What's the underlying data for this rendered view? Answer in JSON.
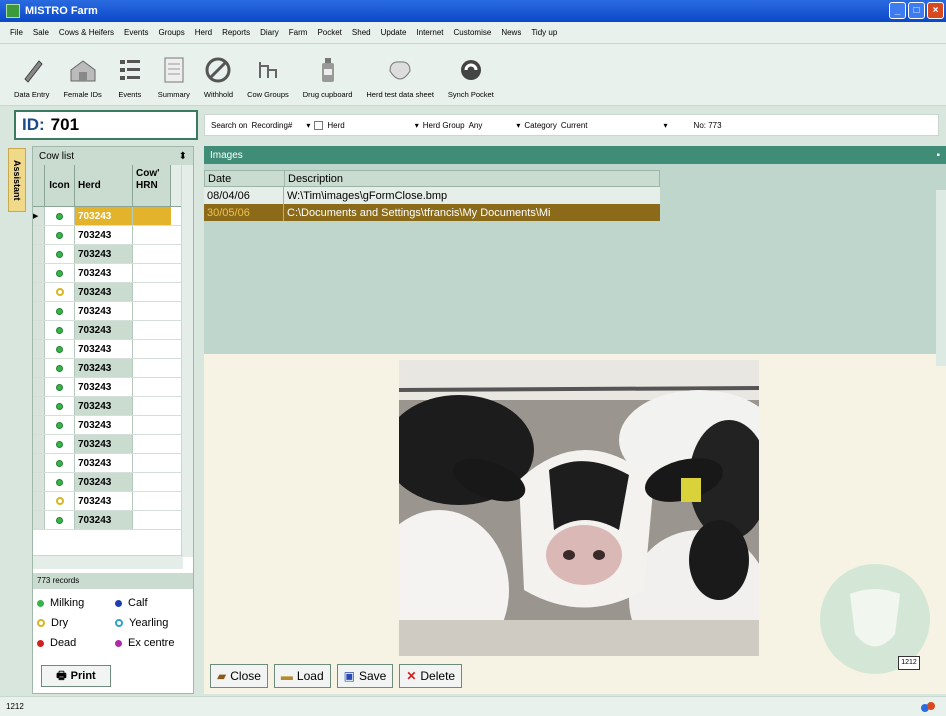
{
  "window": {
    "title": "MISTRO Farm"
  },
  "menu": [
    "File",
    "Sale",
    "Cows & Heifers",
    "Events",
    "Groups",
    "Herd",
    "Reports",
    "Diary",
    "Farm",
    "Pocket",
    "Shed",
    "Update",
    "Internet",
    "Customise",
    "News",
    "Tidy up"
  ],
  "toolbar": [
    {
      "label": "Data Entry",
      "icon": "pencil-icon"
    },
    {
      "label": "Female IDs",
      "icon": "barn-icon"
    },
    {
      "label": "Events",
      "icon": "list-icon"
    },
    {
      "label": "Summary",
      "icon": "document-icon"
    },
    {
      "label": "Withhold",
      "icon": "no-entry-icon"
    },
    {
      "label": "Cow Groups",
      "icon": "groups-icon"
    },
    {
      "label": "Drug cupboard",
      "icon": "bottle-icon"
    },
    {
      "label": "Herd test data sheet",
      "icon": "glove-icon"
    },
    {
      "label": "Synch Pocket",
      "icon": "sync-icon"
    }
  ],
  "id_box": {
    "label": "ID:",
    "value": "701"
  },
  "search": {
    "search_on_label": "Search on",
    "search_on_value": "Recording#",
    "herd_label": "Herd",
    "herd_group_label": "Herd Group",
    "herd_group_value": "Any",
    "category_label": "Category",
    "category_value": "Current",
    "count_label": "No: 773"
  },
  "assistant": {
    "label": "Assistant"
  },
  "cow_list": {
    "title": "Cow list",
    "columns": {
      "icon": "Icon",
      "herd": "Herd",
      "hrn": "Cow' HRN"
    },
    "rows": [
      {
        "status": "green",
        "herd": "703243",
        "selected": true
      },
      {
        "status": "green",
        "herd": "703243"
      },
      {
        "status": "green",
        "herd": "703243"
      },
      {
        "status": "green",
        "herd": "703243"
      },
      {
        "status": "yellow",
        "herd": "703243"
      },
      {
        "status": "green",
        "herd": "703243"
      },
      {
        "status": "green",
        "herd": "703243"
      },
      {
        "status": "green",
        "herd": "703243"
      },
      {
        "status": "green",
        "herd": "703243"
      },
      {
        "status": "green",
        "herd": "703243"
      },
      {
        "status": "green",
        "herd": "703243"
      },
      {
        "status": "green",
        "herd": "703243"
      },
      {
        "status": "green",
        "herd": "703243"
      },
      {
        "status": "green",
        "herd": "703243"
      },
      {
        "status": "green",
        "herd": "703243"
      },
      {
        "status": "yellow",
        "herd": "703243"
      },
      {
        "status": "green",
        "herd": "703243"
      }
    ],
    "records": "773 records",
    "legend": [
      {
        "label": "Milking",
        "color": "#35b44a"
      },
      {
        "label": "Calf",
        "color": "#1f3fb0"
      },
      {
        "label": "Dry",
        "color": "#d8b520"
      },
      {
        "label": "Yearling",
        "color": "#2fa3c8"
      },
      {
        "label": "Dead",
        "color": "#d22020"
      },
      {
        "label": "Ex centre",
        "color": "#b02aa8"
      }
    ],
    "print_label": "Print"
  },
  "images": {
    "title": "Images",
    "columns": {
      "date": "Date",
      "description": "Description"
    },
    "rows": [
      {
        "date": "08/04/06",
        "description": "W:\\Tim\\images\\gFormClose.bmp"
      },
      {
        "date": "30/05/06",
        "description": "C:\\Documents and Settings\\tfrancis\\My Documents\\Mi"
      }
    ],
    "buttons": {
      "close": "Close",
      "load": "Load",
      "save": "Save",
      "delete": "Delete"
    },
    "clock": "1212"
  },
  "status": {
    "left": "1212"
  }
}
